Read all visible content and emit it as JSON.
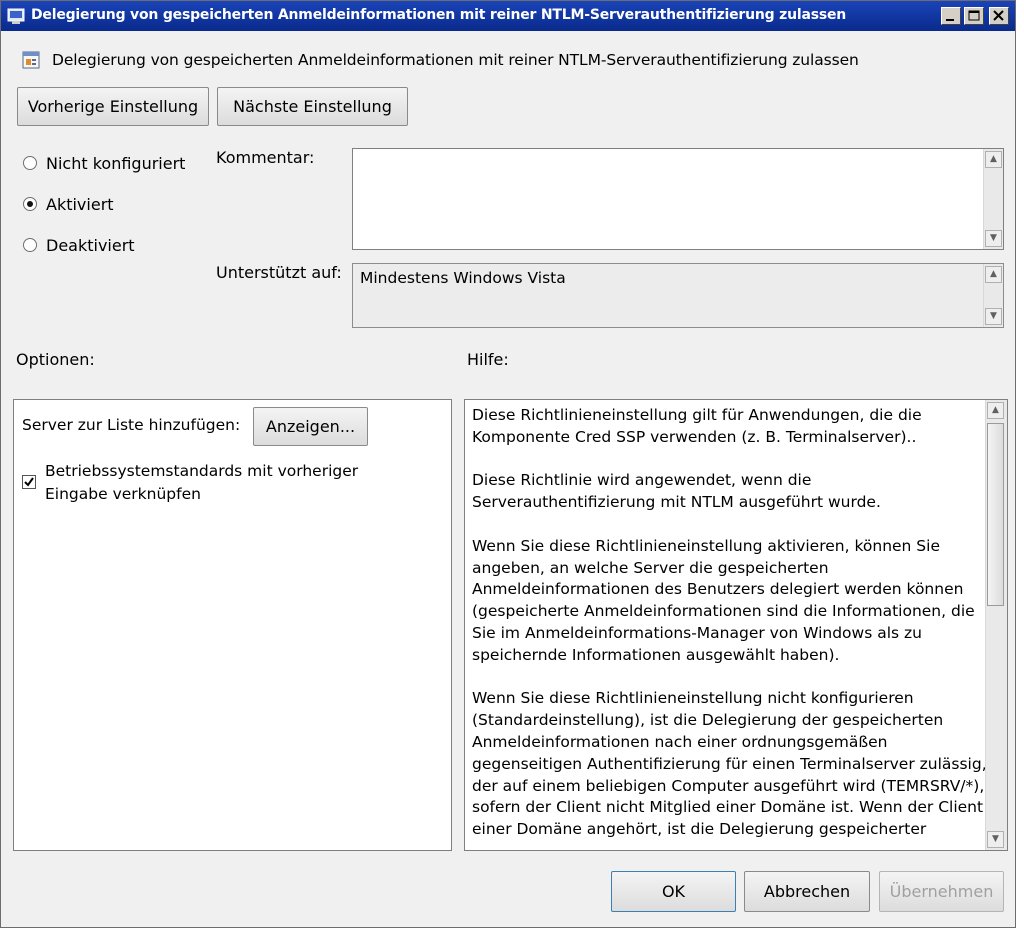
{
  "window": {
    "title": "Delegierung von gespeicherten Anmeldeinformationen mit reiner NTLM-Serverauthentifizierung zulassen",
    "minimize_icon": "minimize-icon",
    "maximize_icon": "maximize-icon",
    "close_icon": "close-icon",
    "app_icon": "policy-icon"
  },
  "header": {
    "policy_title": "Delegierung von gespeicherten Anmeldeinformationen mit reiner NTLM-Serverauthentifizierung zulassen",
    "icon": "policy-setting-icon"
  },
  "nav": {
    "prev_label": "Vorherige Einstellung",
    "next_label": "Nächste Einstellung"
  },
  "state": {
    "options": [
      {
        "label": "Nicht konfiguriert",
        "selected": false
      },
      {
        "label": "Aktiviert",
        "selected": true
      },
      {
        "label": "Deaktiviert",
        "selected": false
      }
    ]
  },
  "comment": {
    "label": "Kommentar:",
    "value": ""
  },
  "supported": {
    "label": "Unterstützt auf:",
    "value": "Mindestens Windows Vista"
  },
  "options_panel": {
    "heading": "Optionen:",
    "server_list_label": "Server zur Liste hinzufügen:",
    "show_button": "Anzeigen...",
    "concat_checkbox": {
      "checked": true,
      "line1": "Betriebssystemstandards mit vorheriger",
      "line2": "Eingabe verknüpfen"
    }
  },
  "help_panel": {
    "heading": "Hilfe:",
    "paragraphs": [
      [
        "Diese Richtlinieneinstellung gilt für Anwendungen, die die",
        "Komponente Cred SSP verwenden (z. B. Terminalserver).."
      ],
      [
        "Diese Richtlinie wird angewendet, wenn die",
        "Serverauthentifizierung mit NTLM ausgeführt wurde."
      ],
      [
        "Wenn Sie diese Richtlinieneinstellung aktivieren, können Sie",
        "angeben, an welche Server die gespeicherten",
        "Anmeldeinformationen des Benutzers delegiert werden können",
        "(gespeicherte Anmeldeinformationen sind die Informationen, die",
        "Sie im Anmeldeinformations-Manager von Windows als zu",
        "speichernde Informationen ausgewählt haben)."
      ],
      [
        "Wenn Sie diese Richtlinieneinstellung nicht konfigurieren",
        "(Standardeinstellung), ist die Delegierung der gespeicherten",
        "Anmeldeinformationen nach einer ordnungsgemäßen",
        "gegenseitigen Authentifizierung für einen Terminalserver zulässig,",
        "der auf einem beliebigen Computer ausgeführt wird (TEMRSRV/*),",
        "sofern der Client nicht Mitglied einer Domäne ist. Wenn der Client",
        "einer Domäne angehört, ist die Delegierung gespeicherter"
      ]
    ]
  },
  "footer": {
    "ok_label": "OK",
    "cancel_label": "Abbrechen",
    "apply_label": "Übernehmen"
  },
  "colors": {
    "titlebar": "#0a2a8c",
    "dialog_bg": "#f0f0f0",
    "disabled_text": "#a0a0a0"
  }
}
